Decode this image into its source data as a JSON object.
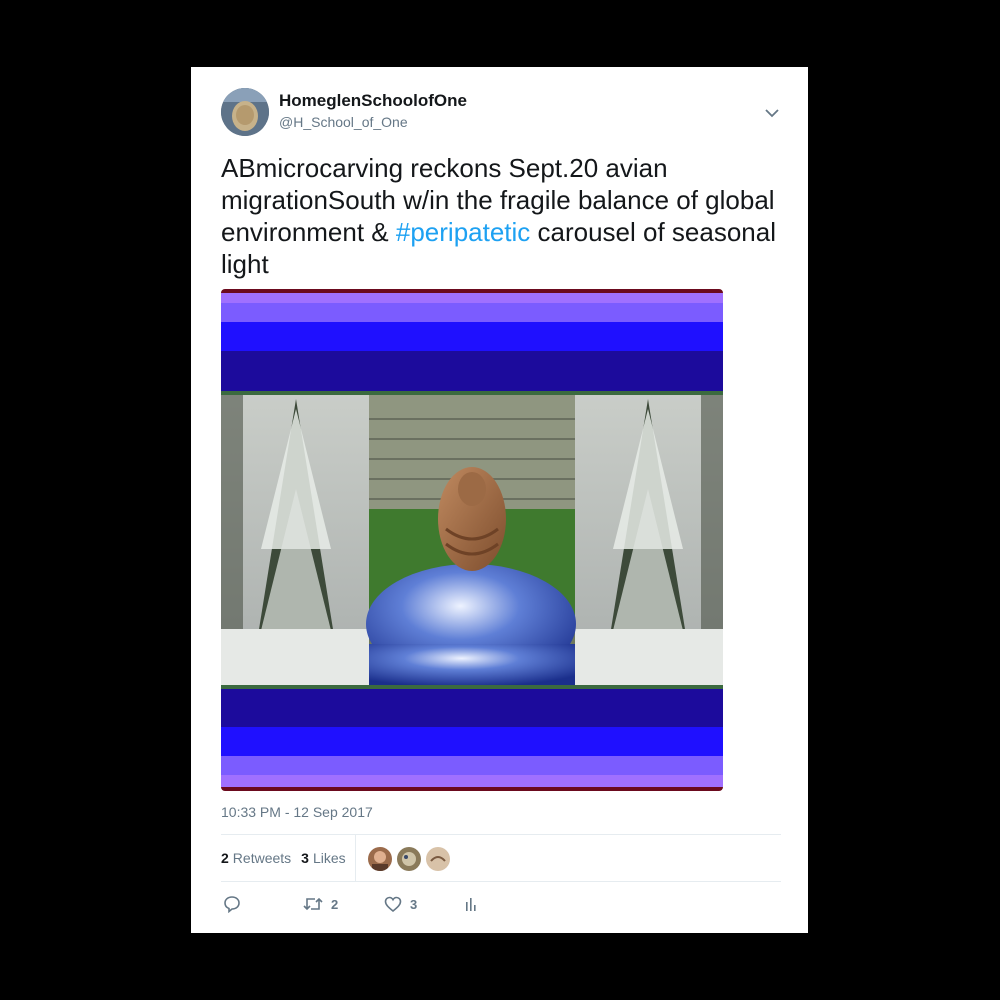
{
  "user": {
    "display_name": "HomeglenSchoolofOne",
    "handle": "@H_School_of_One"
  },
  "tweet": {
    "text_before": "ABmicrocarving reckons Sept.20 avian migrationSouth w/in the fragile balance of global environment & ",
    "hashtag": "#peripatetic",
    "text_after": " carousel of seasonal light",
    "timestamp": "10:33 PM - 12 Sep 2017"
  },
  "stats": {
    "retweets_count": "2",
    "retweets_label": "Retweets",
    "likes_count": "3",
    "likes_label": "Likes"
  },
  "actions": {
    "retweet_count": "2",
    "like_count": "3"
  },
  "colors": {
    "link": "#1da1f2",
    "text": "#14171a",
    "muted": "#657786"
  },
  "icons": [
    "chevron-down-icon",
    "reply-icon",
    "retweet-icon",
    "heart-icon",
    "analytics-icon"
  ]
}
